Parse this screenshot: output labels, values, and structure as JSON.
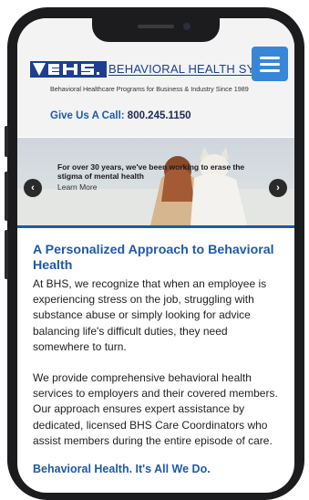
{
  "header": {
    "brand_name": "BEHAVIORAL HEALTH SYS",
    "tagline": "Behavioral Healthcare Programs for Business & Industry Since 1989",
    "call_label": "Give Us A Call:",
    "phone_number": "800.245.1150"
  },
  "hero": {
    "text": "For over 30 years, we've been working to erase the stigma of mental health",
    "link": "Learn More",
    "prev_arrow": "‹",
    "next_arrow": "›"
  },
  "main": {
    "heading": "A Personalized Approach to Behavioral Health",
    "paragraph1": "At BHS, we recognize that when an employee is experiencing stress on the job, struggling with substance abuse or simply looking for advice balancing life's difficult duties, they need somewhere to turn.",
    "paragraph2": "We provide comprehensive behavioral health services to employers and their covered members. Our approach ensures expert assistance by dedicated, licensed BHS Care Coordinators who assist members during the entire episode of care.",
    "subheading": "Behavioral Health. It's All We Do."
  },
  "colors": {
    "brand_blue": "#1e5aa8",
    "menu_blue": "#3a86d6",
    "dark_navy": "#1c2a52"
  }
}
